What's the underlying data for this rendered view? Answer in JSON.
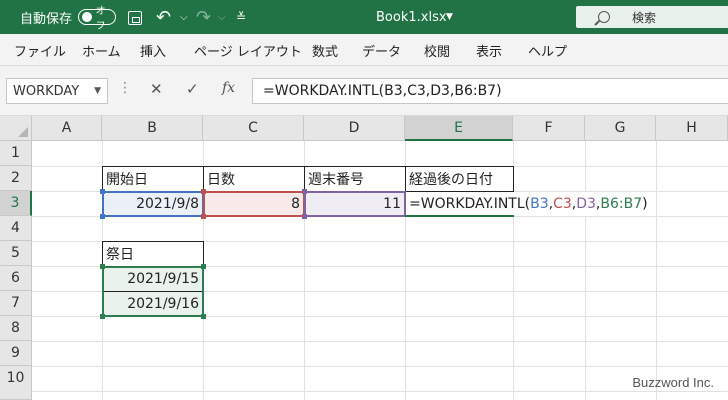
{
  "titlebar": {
    "autosave_label": "自動保存",
    "autosave_state": "オフ",
    "document_title": "Book1.xlsx",
    "search_placeholder": "検索"
  },
  "ribbon": {
    "tabs": [
      "ファイル",
      "ホーム",
      "挿入",
      "ページ レイアウト",
      "数式",
      "データ",
      "校閲",
      "表示",
      "ヘルプ"
    ]
  },
  "formula_bar": {
    "name_box": "WORKDAY",
    "fx": "fx",
    "formula": "=WORKDAY.INTL(B3,C3,D3,B6:B7)"
  },
  "grid": {
    "columns": [
      "A",
      "B",
      "C",
      "D",
      "E",
      "F",
      "G",
      "H"
    ],
    "rows": [
      "1",
      "2",
      "3",
      "4",
      "5",
      "6",
      "7",
      "8",
      "9",
      "10"
    ],
    "active_column": "E",
    "active_row": "3"
  },
  "cells": {
    "B2": "開始日",
    "C2": "日数",
    "D2": "週末番号",
    "E2": "経過後の日付",
    "B3": "2021/9/8",
    "C3": "8",
    "D3": "11",
    "B5": "祭日",
    "B6": "2021/9/15",
    "B7": "2021/9/16"
  },
  "edit_formula": {
    "prefix": "=WORKDAY.INTL(",
    "arg1": "B3",
    "sep1": ",",
    "arg2": "C3",
    "sep2": ",",
    "arg3": "D3",
    "sep3": ",",
    "arg4": "B6:B7",
    "suffix": ")"
  },
  "colors": {
    "brand": "#217346",
    "ref1": "#4472c4",
    "ref2": "#c0504d",
    "ref3": "#8064a2",
    "ref4": "#2e7d4f"
  },
  "watermark": "Buzzword Inc."
}
